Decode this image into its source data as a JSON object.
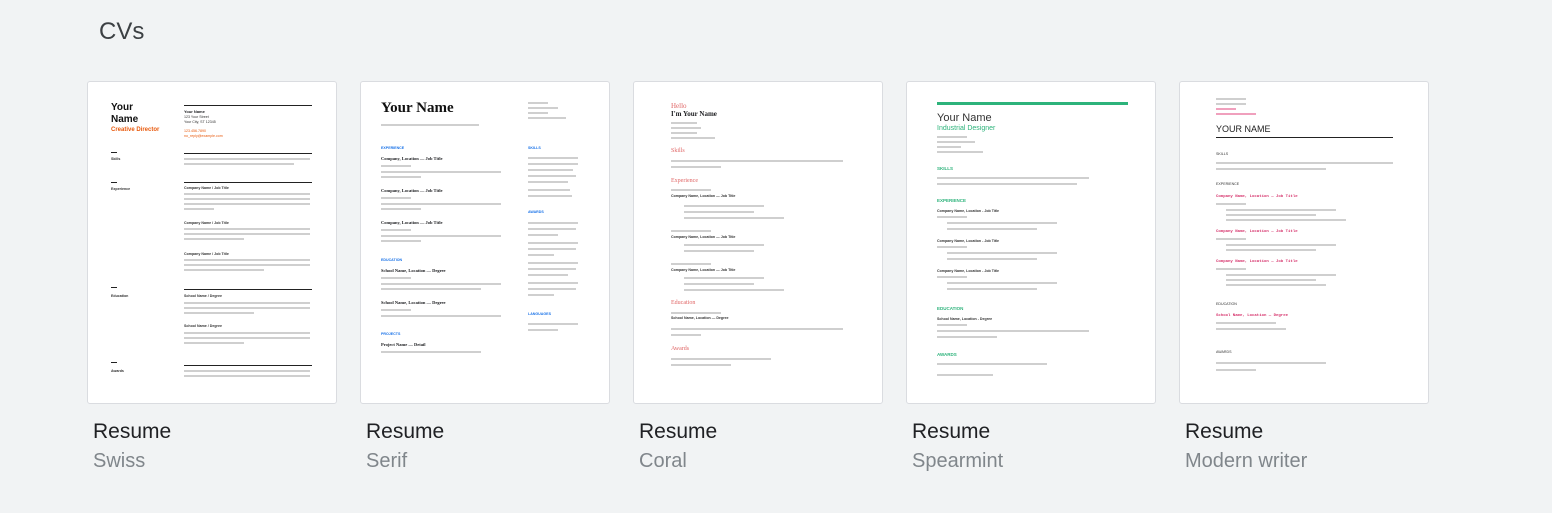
{
  "section": {
    "title": "CVs"
  },
  "templates": [
    {
      "label": "Resume",
      "sublabel": "Swiss",
      "preview": {
        "name_line1": "Your",
        "name_line2": "Name",
        "title": "Creative Director",
        "contact_name": "Your Name",
        "contact_street": "123 Your Street",
        "contact_city": "Your City, ST 12345",
        "contact_phone": "123.456.7890",
        "contact_email": "no_reply@example.com",
        "skills": "Skills",
        "experience": "Experience",
        "education": "Education",
        "awards": "Awards",
        "job1": "Company Name / Job Title",
        "job2": "Company Name / Job Title",
        "job3": "Company Name / Job Title",
        "school1": "School Name / Degree",
        "school2": "School Name / Degree"
      }
    },
    {
      "label": "Resume",
      "sublabel": "Serif",
      "preview": {
        "name": "Your Name",
        "experience": "EXPERIENCE",
        "skills": "SKILLS",
        "education": "EDUCATION",
        "awards": "AWARDS",
        "projects": "PROJECTS",
        "languages": "LANGUAGES",
        "job1": "Company, Location — Job Title",
        "job2": "Company, Location — Job Title",
        "job3": "Company, Location — Job Title",
        "school1": "School Name, Location — Degree",
        "school2": "School Name, Location — Degree",
        "project": "Project Name — Detail"
      }
    },
    {
      "label": "Resume",
      "sublabel": "Coral",
      "preview": {
        "hello": "Hello",
        "name": "I'm Your Name",
        "skills": "Skills",
        "experience": "Experience",
        "education": "Education",
        "awards": "Awards",
        "job1": "Company Name, Location — Job Title",
        "job2": "Company Name, Location — Job Title",
        "job3": "Company Name, Location — Job Title",
        "school": "School Name, Location — Degree"
      }
    },
    {
      "label": "Resume",
      "sublabel": "Spearmint",
      "preview": {
        "name": "Your Name",
        "title": "Industrial Designer",
        "skills": "SKILLS",
        "experience": "EXPERIENCE",
        "education": "EDUCATION",
        "awards": "AWARDS",
        "job1": "Company Name, Location - Job Title",
        "job2": "Company Name, Location - Job Title",
        "job3": "Company Name, Location - Job Title",
        "school": "School Name, Location - Degree"
      }
    },
    {
      "label": "Resume",
      "sublabel": "Modern writer",
      "preview": {
        "name": "YOUR NAME",
        "skills": "SKILLS",
        "experience": "EXPERIENCE",
        "education": "EDUCATION",
        "awards": "AWARDS",
        "job1": "Company Name, Location — Job Title",
        "job2": "Company Name, Location — Job Title",
        "job3": "Company Name, Location — Job Title",
        "school": "School Name, Location — Degree"
      }
    }
  ],
  "colors": {
    "background": "#f1f3f4",
    "swiss_accent": "#e8590c",
    "serif_accent": "#1a73e8",
    "coral_accent": "#e06666",
    "spearmint_accent": "#2db37b",
    "writer_accent": "#d6336c"
  }
}
